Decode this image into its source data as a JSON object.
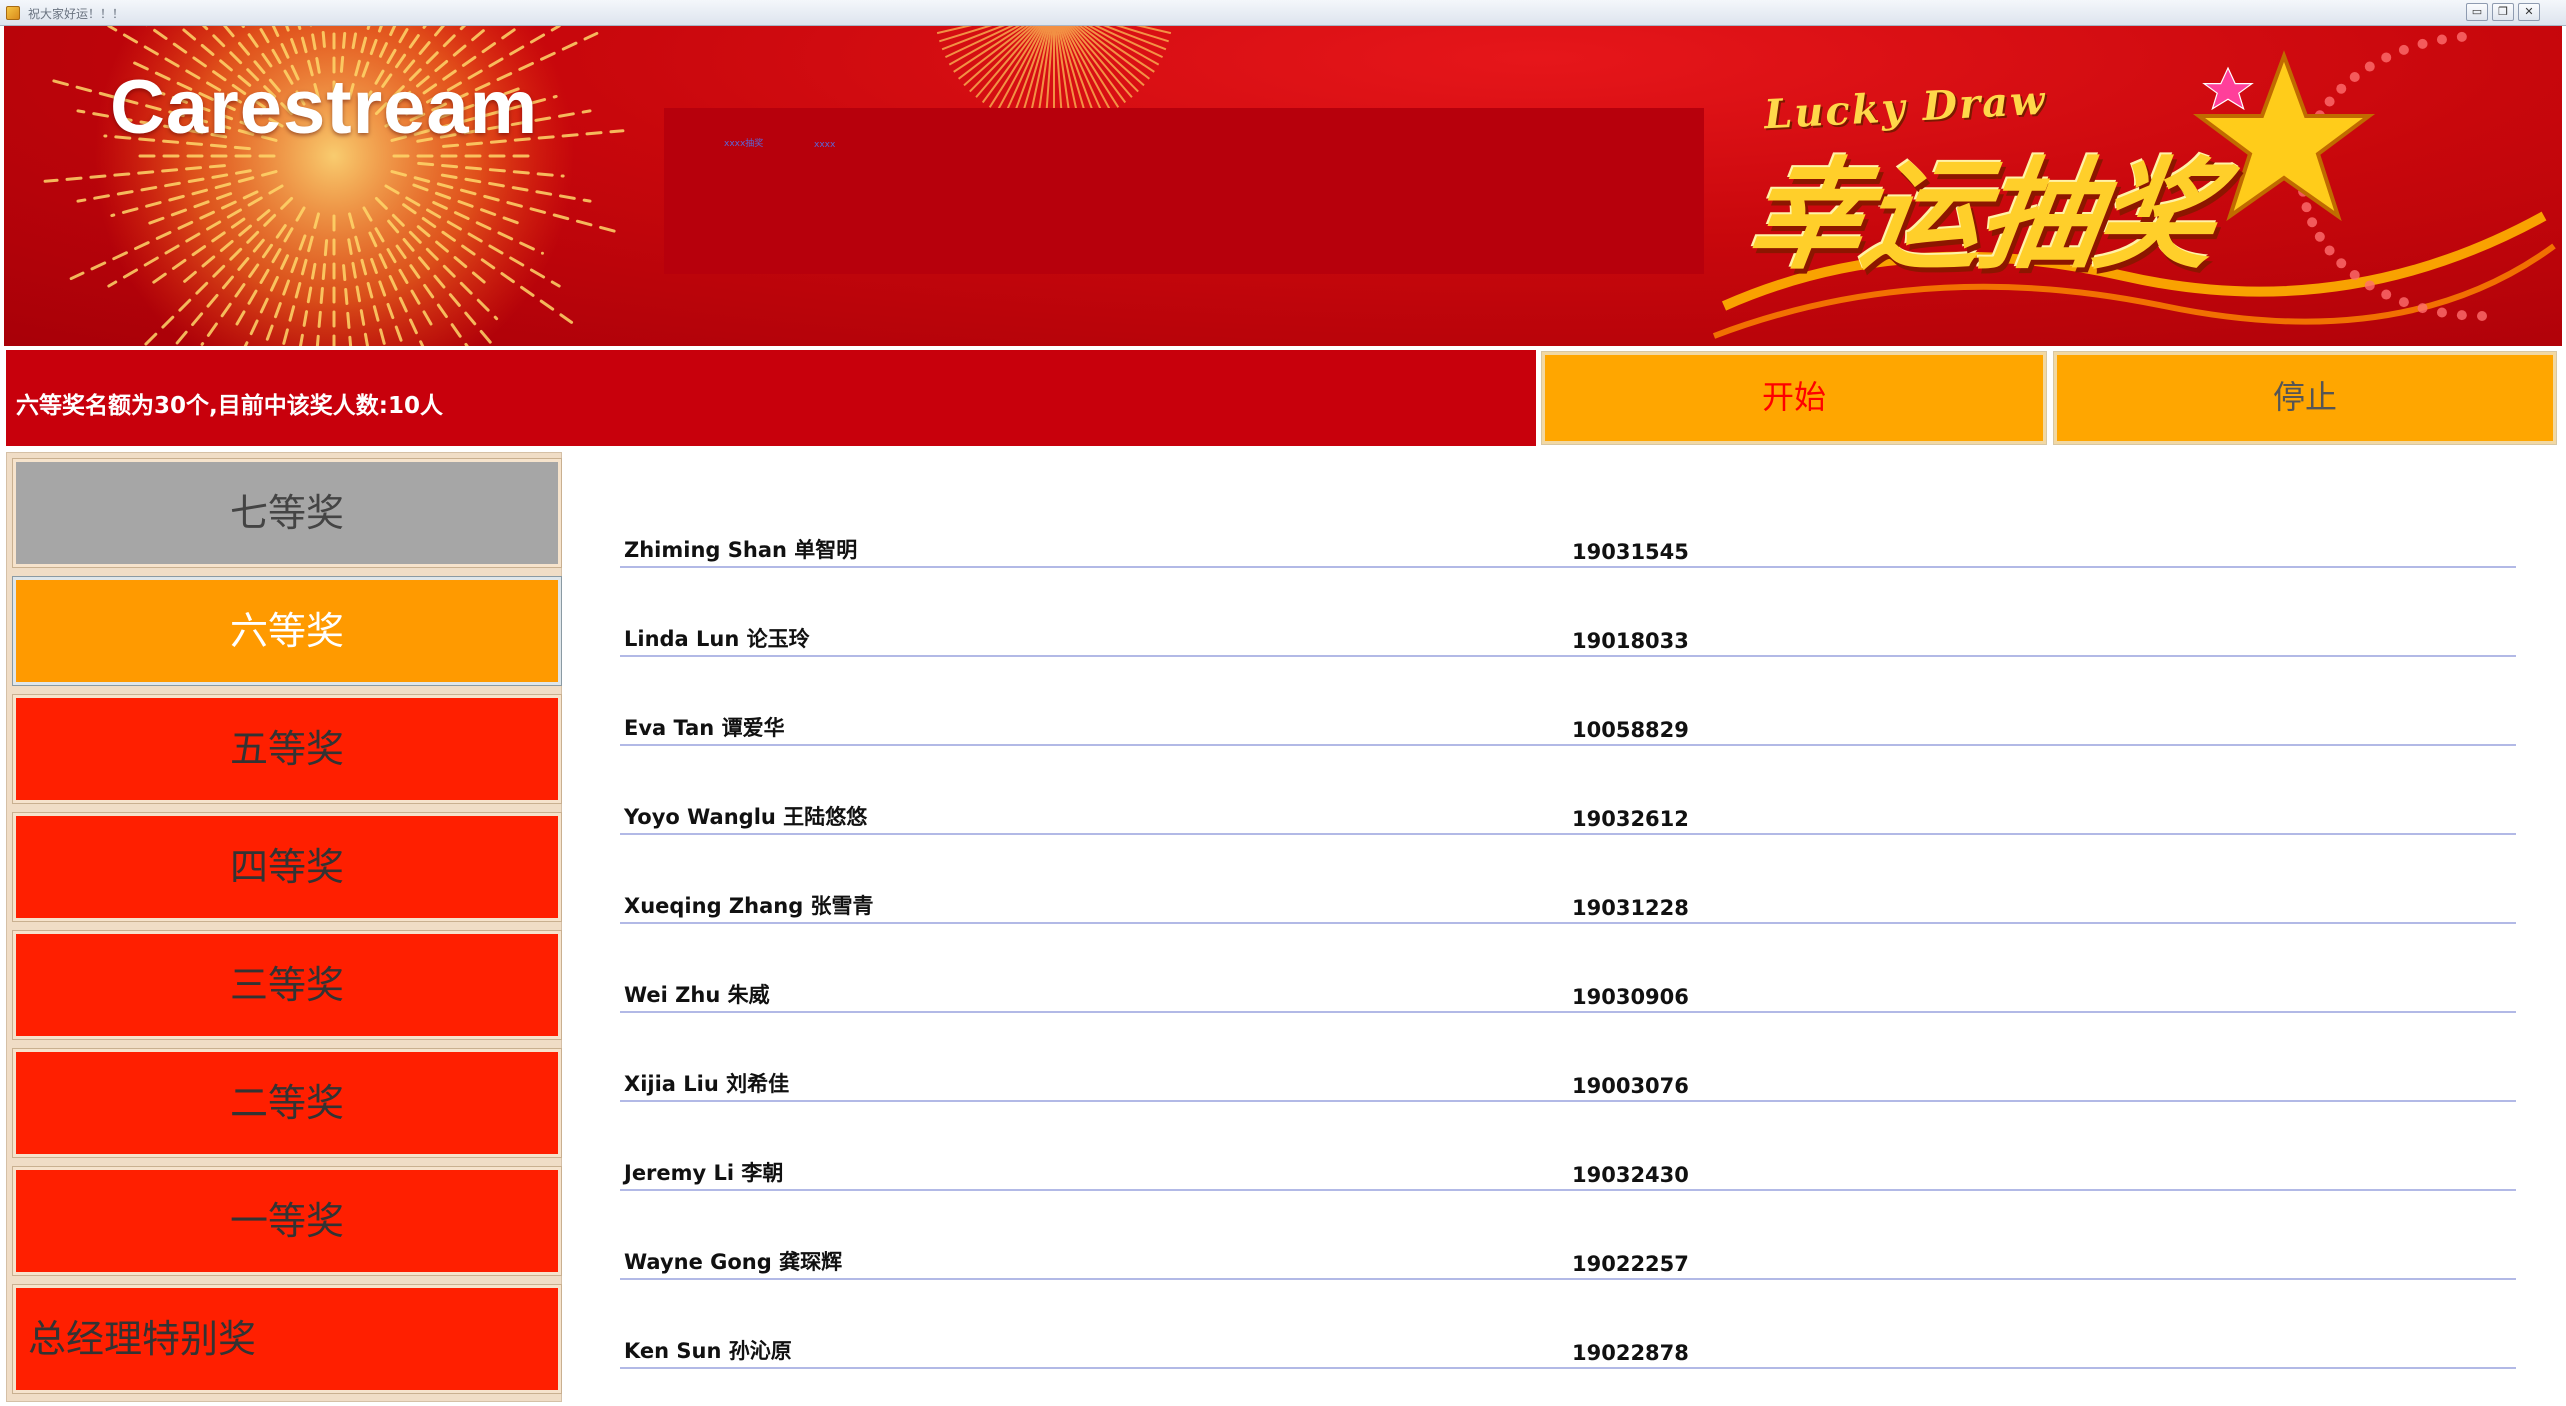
{
  "window": {
    "title": "祝大家好运！！！",
    "controls": [
      "minimize",
      "restore",
      "close"
    ]
  },
  "banner": {
    "logo": "Carestream",
    "tiny_text_1": "xxxx抽奖",
    "tiny_text_2": "xxxx",
    "subtitle_en": "Lucky Draw",
    "subtitle_cn": "幸运抽奖"
  },
  "status": {
    "text": "六等奖名额为30个,目前中该奖人数:10人"
  },
  "actions": {
    "start_label": "开始",
    "stop_label": "停止"
  },
  "prizes": [
    {
      "label": "七等奖",
      "state": "disabled"
    },
    {
      "label": "六等奖",
      "state": "selected"
    },
    {
      "label": "五等奖",
      "state": "normal"
    },
    {
      "label": "四等奖",
      "state": "normal"
    },
    {
      "label": "三等奖",
      "state": "normal"
    },
    {
      "label": "二等奖",
      "state": "normal"
    },
    {
      "label": "一等奖",
      "state": "normal"
    },
    {
      "label": "总经理特别奖",
      "state": "normal"
    }
  ],
  "winners": [
    {
      "name": "Zhiming Shan 单智明",
      "id": "19031545"
    },
    {
      "name": "Linda Lun 论玉玲",
      "id": "19018033"
    },
    {
      "name": "Eva Tan 谭爱华",
      "id": "10058829"
    },
    {
      "name": "Yoyo Wanglu 王陆悠悠",
      "id": "19032612"
    },
    {
      "name": "Xueqing Zhang 张雪青",
      "id": "19031228"
    },
    {
      "name": "Wei Zhu 朱威",
      "id": "19030906"
    },
    {
      "name": "Xijia Liu 刘希佳",
      "id": "19003076"
    },
    {
      "name": "Jeremy Li 李朝",
      "id": "19032430"
    },
    {
      "name": "Wayne Gong 龚琛辉",
      "id": "19022257"
    },
    {
      "name": "Ken Sun 孙沁原",
      "id": "19022878"
    }
  ],
  "colors": {
    "banner_red": "#c8070c",
    "status_red": "#c8000c",
    "button_orange": "#ffa600",
    "prize_red": "#ff1f00",
    "prize_selected": "#ff9a00",
    "prize_disabled": "#a6a6a6",
    "row_line": "#b2b9e6"
  }
}
